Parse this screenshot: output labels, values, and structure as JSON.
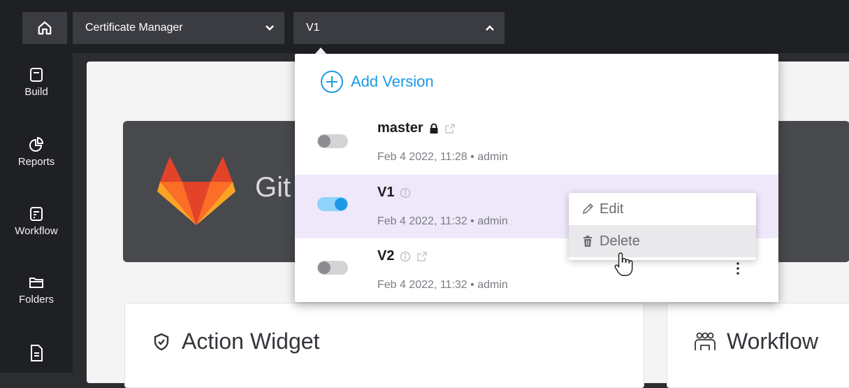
{
  "topbar": {
    "home_icon": "home-icon",
    "app_selector": {
      "value": "Certificate Manager",
      "icon": "chevron-down-icon"
    },
    "version_selector": {
      "value": "V1",
      "icon": "chevron-up-icon"
    }
  },
  "sidebar": {
    "items": [
      {
        "label": "Build",
        "icon": "build-icon"
      },
      {
        "label": "Reports",
        "icon": "pie-chart-icon"
      },
      {
        "label": "Workflow",
        "icon": "workflow-icon"
      },
      {
        "label": "Folders",
        "icon": "folder-icon"
      },
      {
        "label": "",
        "icon": "document-icon"
      }
    ]
  },
  "background": {
    "gitlab_card_text": "Git",
    "widgets": [
      {
        "title": "Action Widget",
        "icon": "shield-check-icon"
      },
      {
        "title": "Workflow",
        "icon": "people-icon"
      }
    ]
  },
  "version_panel": {
    "add_label": "Add Version",
    "versions": [
      {
        "name": "master",
        "meta": "Feb 4 2022, 11:28 • admin",
        "enabled": false,
        "icons": [
          "lock-icon",
          "external-link-icon"
        ]
      },
      {
        "name": "V1",
        "meta": "Feb 4 2022, 11:32 • admin",
        "enabled": true,
        "selected": true,
        "icons": [
          "info-icon"
        ]
      },
      {
        "name": "V2",
        "meta": "Feb 4 2022, 11:32 • admin",
        "enabled": false,
        "icons": [
          "info-icon",
          "external-link-icon"
        ]
      }
    ]
  },
  "context_menu": {
    "items": [
      {
        "label": "Edit",
        "icon": "pencil-icon"
      },
      {
        "label": "Delete",
        "icon": "trash-icon",
        "hovered": true
      }
    ]
  },
  "colors": {
    "accent": "#1b9ae6",
    "selected_row": "#efe8fb",
    "topbar": "#1f2024"
  }
}
